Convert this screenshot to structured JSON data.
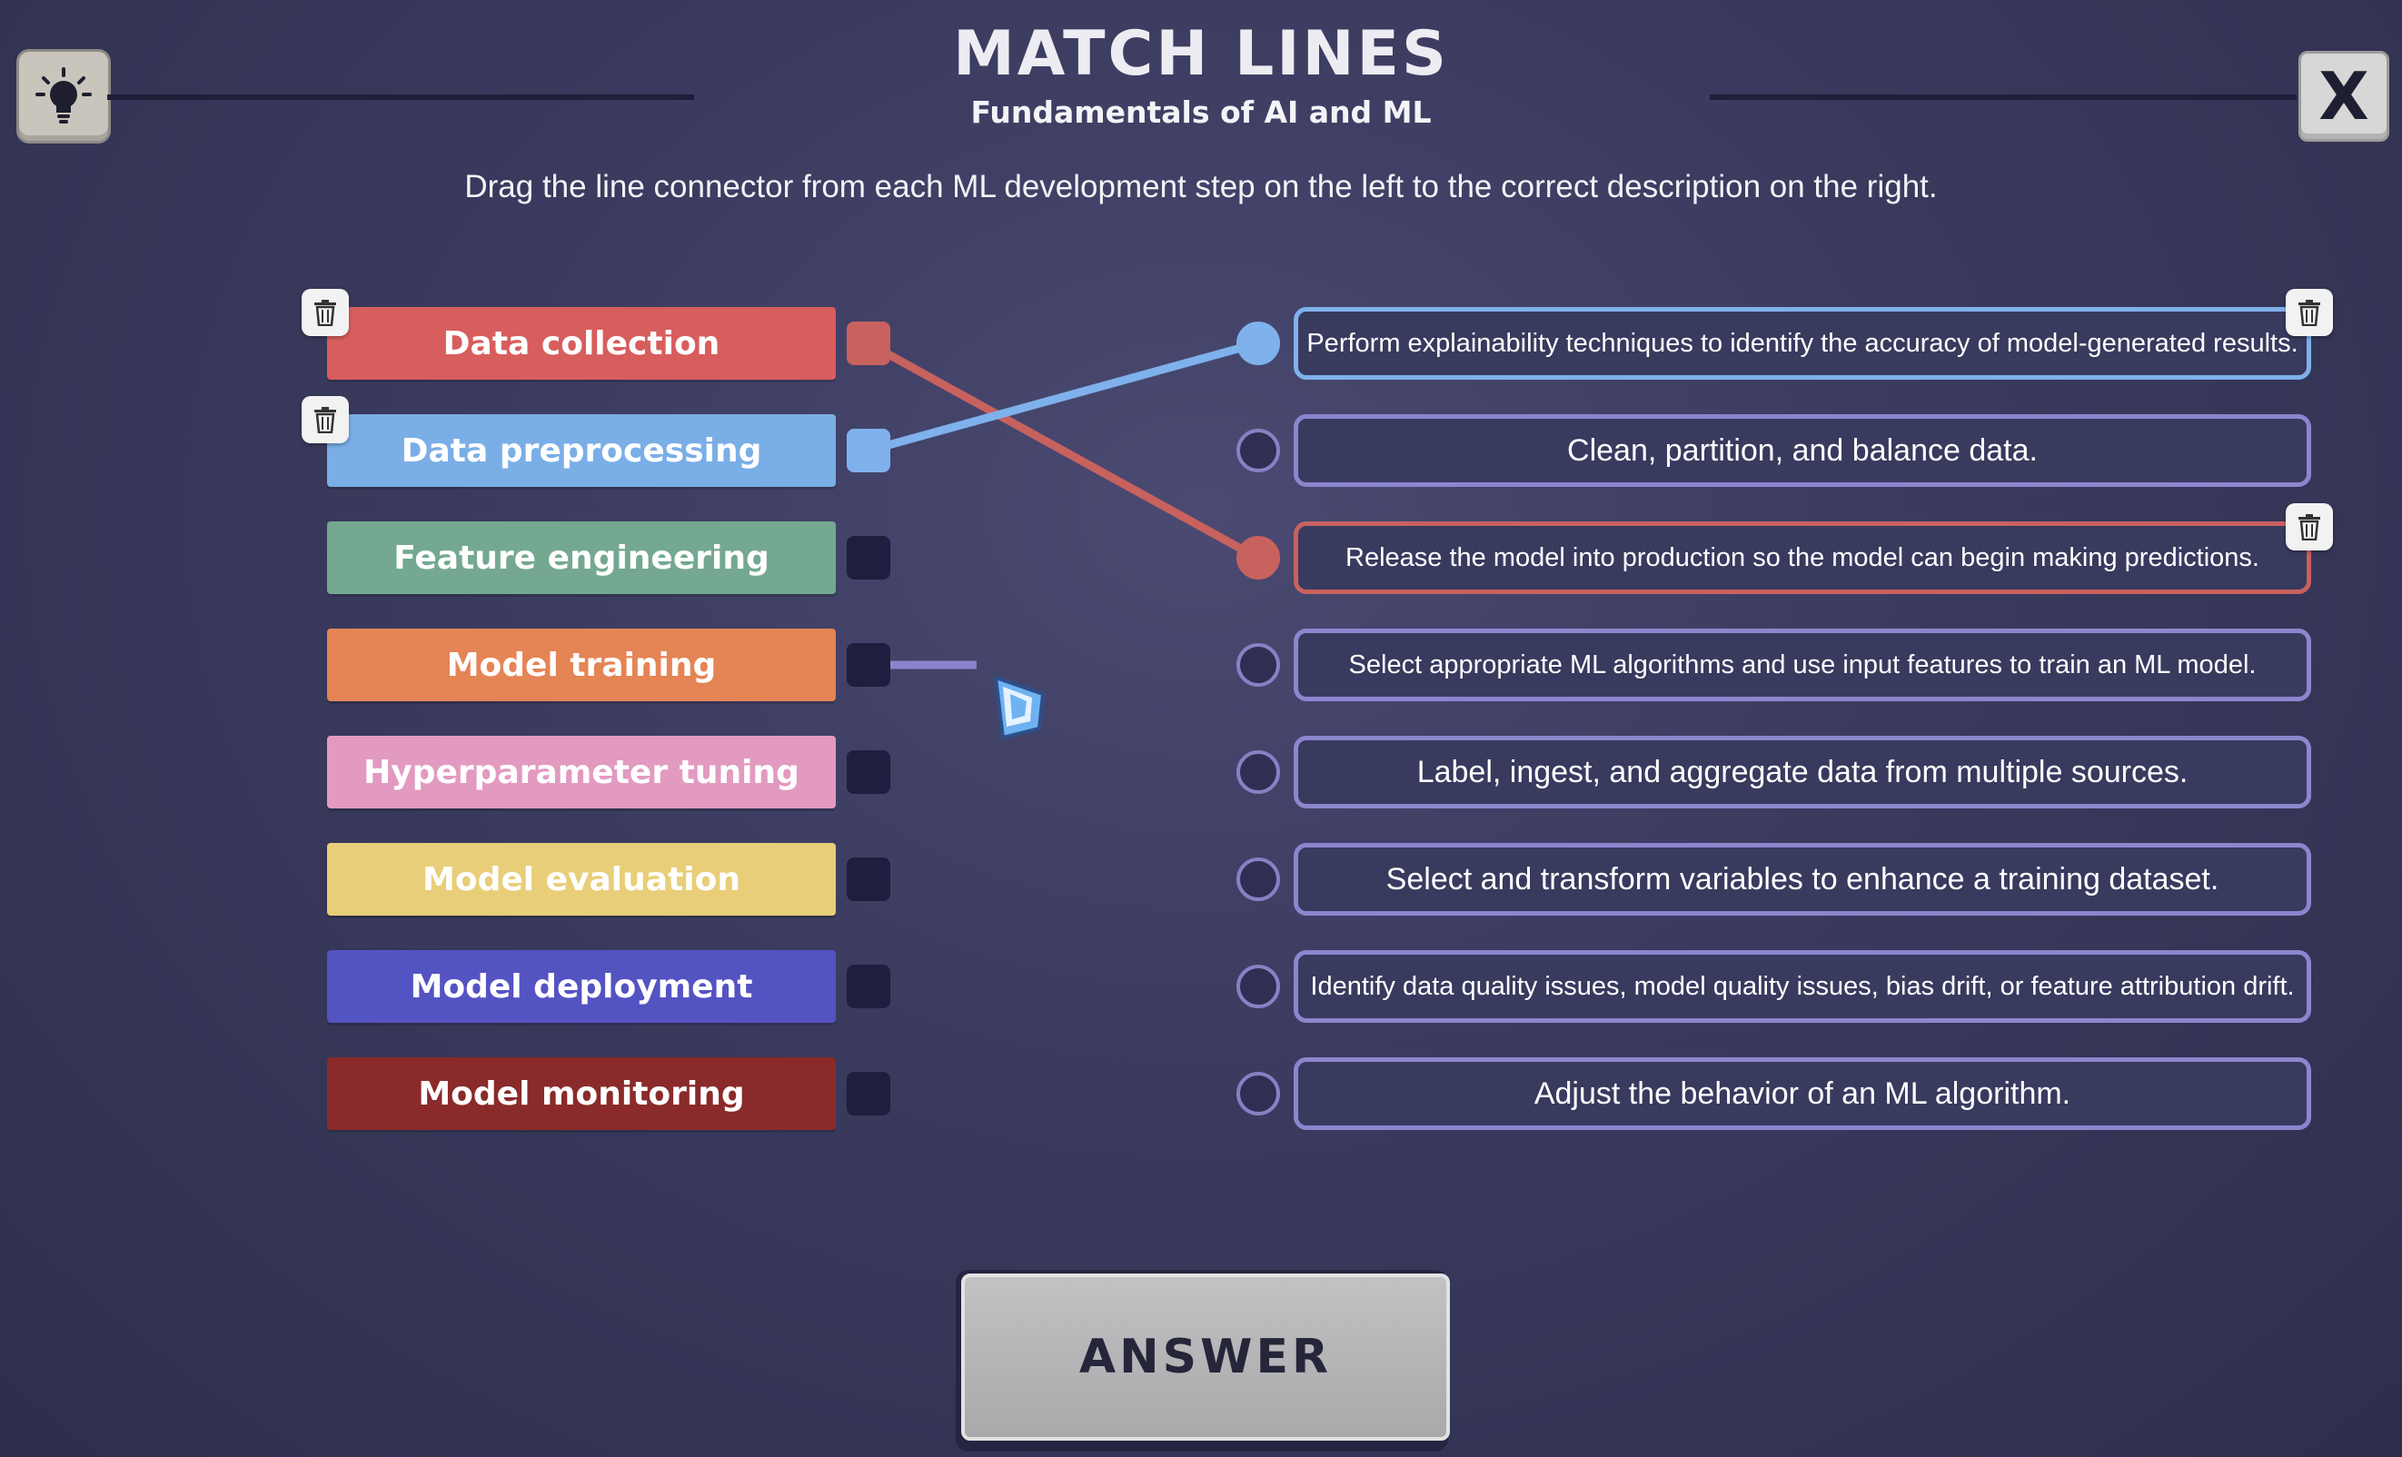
{
  "header": {
    "title": "MATCH LINES",
    "subtitle": "Fundamentals of AI and ML",
    "instructions": "Drag the line connector from each ML development step on the left to the correct description on the right.",
    "hint_icon": "lightbulb-icon",
    "close_label": "X"
  },
  "steps": [
    {
      "label": "Data collection",
      "color": "#d85d5d"
    },
    {
      "label": "Data preprocessing",
      "color": "#7aaee6"
    },
    {
      "label": "Feature engineering",
      "color": "#74a891"
    },
    {
      "label": "Model training",
      "color": "#e58455"
    },
    {
      "label": "Hyperparameter tuning",
      "color": "#e29ac0"
    },
    {
      "label": "Model evaluation",
      "color": "#e8ce78"
    },
    {
      "label": "Model deployment",
      "color": "#5453c2"
    },
    {
      "label": "Model monitoring",
      "color": "#8a2a2a"
    }
  ],
  "descriptions": [
    "Perform explainability techniques to identify the accuracy of model-generated results.",
    "Clean, partition, and balance data.",
    "Release the model into production so the model can begin making predictions.",
    "Select appropriate ML algorithms and use input features to train an ML model.",
    "Label, ingest, and aggregate data from multiple sources.",
    "Select and transform variables to enhance a training dataset.",
    "Identify data quality issues, model quality issues, bias drift, or feature attribution drift.",
    "Adjust the behavior of an ML algorithm."
  ],
  "connections": [
    {
      "step": "Data collection",
      "description": "Release the model into production so the model can begin making predictions.",
      "color": "#c8625e"
    },
    {
      "step": "Data preprocessing",
      "description": "Perform explainability techniques to identify the accuracy of model-generated results.",
      "color": "#7fb1ec"
    }
  ],
  "dragging": {
    "step": "Model training",
    "color": "#8a84cc"
  },
  "icons": {
    "delete": "trash-icon",
    "cursor": "drag-hand-cursor-icon"
  },
  "answer_label": "ANSWER"
}
